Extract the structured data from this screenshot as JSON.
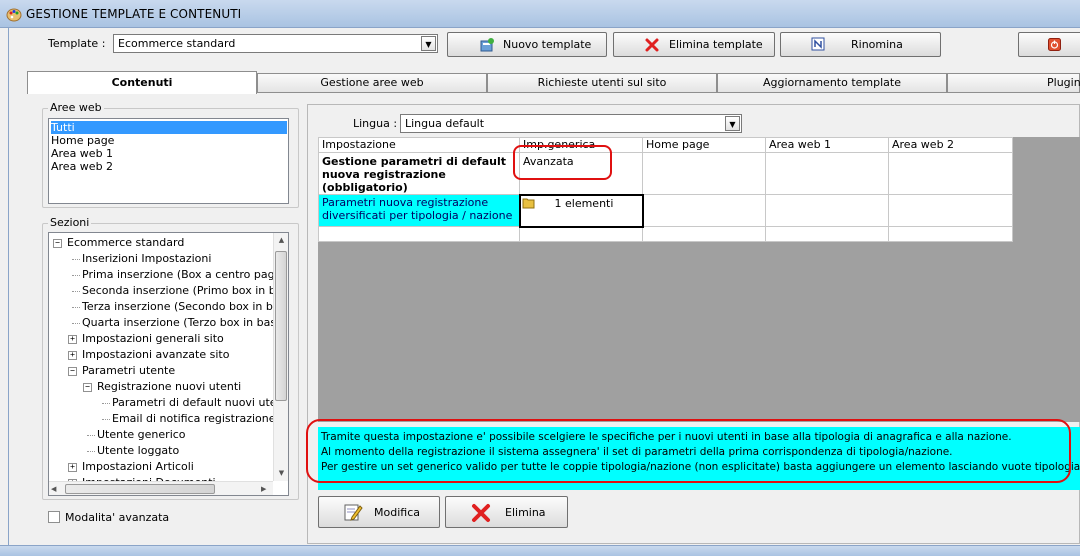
{
  "window": {
    "title": "GESTIONE TEMPLATE E CONTENUTI"
  },
  "toolbar": {
    "template_label": "Template :",
    "template_value": "Ecommerce standard",
    "new_label": "Nuovo template",
    "delete_label": "Elimina template",
    "rename_label": "Rinomina"
  },
  "tabs": [
    "Contenuti",
    "Gestione aree web",
    "Richieste utenti sul sito",
    "Aggiornamento template",
    "Plugins"
  ],
  "aree_web": {
    "legend": "Aree web",
    "items": [
      "Tutti",
      "Home page",
      "Area web 1",
      "Area web 2"
    ]
  },
  "sezioni": {
    "legend": "Sezioni",
    "items": [
      {
        "label": "Ecommerce standard",
        "expander": "−"
      },
      {
        "label": "Inserizioni Impostazioni",
        "expander": ""
      },
      {
        "label": "Prima inserzione (Box a centro pagina)",
        "expander": ""
      },
      {
        "label": "Seconda inserzione (Primo box in basso)",
        "expander": ""
      },
      {
        "label": "Terza inserzione (Secondo box in basso)",
        "expander": ""
      },
      {
        "label": "Quarta inserzione (Terzo box in basso)",
        "expander": ""
      },
      {
        "label": "Impostazioni generali sito",
        "expander": "+"
      },
      {
        "label": "Impostazioni avanzate sito",
        "expander": "+"
      },
      {
        "label": "Parametri utente",
        "expander": "−"
      },
      {
        "label": "Registrazione nuovi utenti",
        "expander": "−"
      },
      {
        "label": "Parametri di default nuovi utenti",
        "expander": ""
      },
      {
        "label": "Email di notifica registrazione utente",
        "expander": ""
      },
      {
        "label": "Utente generico",
        "expander": ""
      },
      {
        "label": "Utente loggato",
        "expander": ""
      },
      {
        "label": "Impostazioni Articoli",
        "expander": "+"
      },
      {
        "label": "Impostazioni Documenti",
        "expander": "+"
      }
    ]
  },
  "advanced_mode_label": "Modalita' avanzata",
  "lingua": {
    "label": "Lingua :",
    "value": "Lingua default"
  },
  "grid": {
    "headers": [
      "Impostazione",
      "Imp.generica",
      "Home page",
      "Area web 1",
      "Area web 2"
    ],
    "row1": {
      "setting": "Gestione parametri di default nuova registrazione (obbligatorio)",
      "value": "Avanzata"
    },
    "row2": {
      "setting": "Parametri nuova registrazione diversificati per tipologia / nazione",
      "value": "1 elementi"
    }
  },
  "info": {
    "line1": "Tramite questa impostazione e' possibile scelgiere le specifiche per i nuovi utenti in base alla tipologia di anagrafica e alla nazione.",
    "line2": "Al momento della registrazione il sistema assegnera' il set di parametri della prima corrispondenza di tipologia/nazione.",
    "line3": "Per gestire un set generico valido per tutte le coppie tipologia/nazione (non esplicitate) basta aggiungere un elemento lasciando vuote tipologia e nazione."
  },
  "actions": {
    "modify_label": "Modifica",
    "delete_label": "Elimina"
  },
  "colors": {
    "info_bg": "#00ffff",
    "selection": "#3399ff",
    "highlight": "#e01010",
    "grid_area": "#a0a0a0"
  }
}
